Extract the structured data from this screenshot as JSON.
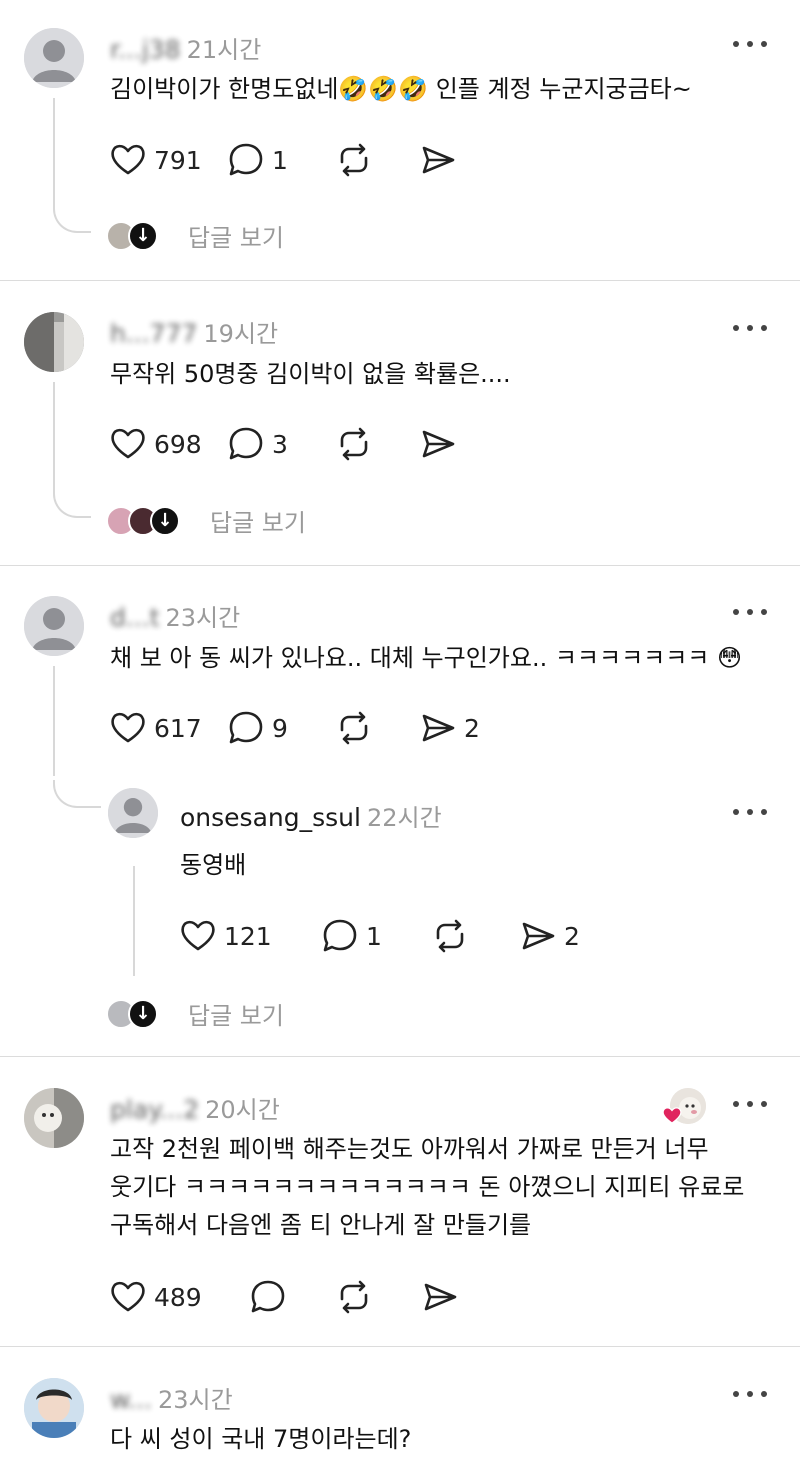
{
  "posts": [
    {
      "username": "r...j38",
      "time": "21시간",
      "text": "김이박이가 한명도없네🤣🤣🤣 인플 계정 누군지궁금타~",
      "likes": "791",
      "comments": "1",
      "shares": "",
      "replies_label": "답글 보기"
    },
    {
      "username": "h...777",
      "time": "19시간",
      "text": "무작위 50명중 김이박이 없을 확률은....",
      "likes": "698",
      "comments": "3",
      "shares": "",
      "replies_label": "답글 보기"
    },
    {
      "username": "d...t",
      "time": "23시간",
      "text": "채 보 아 동 씨가 있나요.. 대체 누구인가요.. ㅋㅋㅋㅋㅋㅋㅋ 😳",
      "likes": "617",
      "comments": "9",
      "shares": "2",
      "reply": {
        "username": "onsesang_ssul",
        "time": "22시간",
        "text": "동영배",
        "likes": "121",
        "comments": "1",
        "shares": "2"
      },
      "replies_label": "답글 보기"
    },
    {
      "username": "play...2",
      "time": "20시간",
      "text": "고작 2천원 페이백 해주는것도 아까워서 가짜로 만든거 너무\n웃기다 ㅋㅋㅋㅋㅋㅋㅋㅋㅋㅋㅋㅋㅋ 돈 아꼈으니 지피티 유료로\n구독해서 다음엔 좀 티 안나게 잘 만들기를",
      "likes": "489",
      "comments": "",
      "shares": ""
    },
    {
      "username": "w...",
      "time": "23시간",
      "text": "다 씨 성이 국내 7명이라는데?"
    }
  ],
  "icons": {
    "like": "heart-icon",
    "comment": "speech-bubble-icon",
    "repost": "repost-icon",
    "share": "send-icon",
    "more": "more-dots-icon"
  },
  "colors": {
    "text": "#111111",
    "muted": "#9a9a9a",
    "divider": "#dcdcdc",
    "liked": "#e0245e"
  }
}
